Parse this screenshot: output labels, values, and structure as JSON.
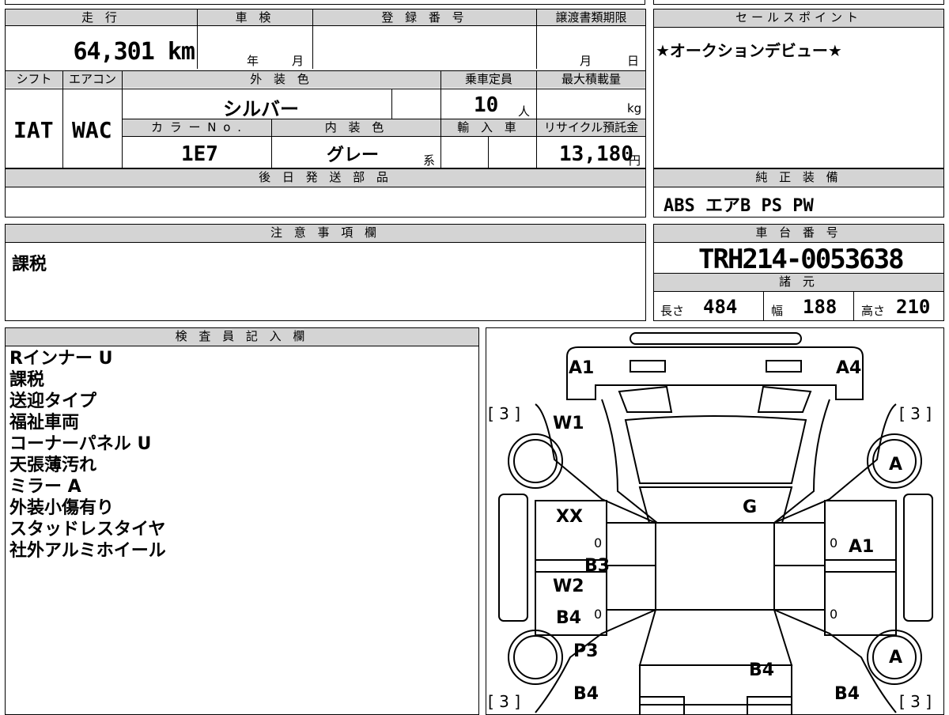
{
  "top": {
    "mileage_label": "走 行",
    "mileage_value": "64,301 km",
    "inspection_label": "車 検",
    "inspection_year": "年",
    "inspection_month": "月",
    "registration_label": "登 録 番 号",
    "transfer_label": "譲渡書類期限",
    "transfer_month": "月",
    "transfer_day": "日"
  },
  "row2": {
    "shift_label": "シフト",
    "aircon_label": "エアコン",
    "exterior_color_label": "外 装 色",
    "capacity_label": "乗車定員",
    "max_load_label": "最大積載量",
    "shift_value": "IAT",
    "aircon_value": "WAC",
    "exterior_color_value": "シルバー",
    "capacity_value": "10",
    "capacity_unit": "人",
    "load_unit": "kg",
    "color_no_label": "カ ラ ー N o .",
    "interior_color_label": "内 装 色",
    "import_label": "輸 入 車",
    "recycle_label": "リサイクル預託金",
    "color_no_value": "1E7",
    "interior_color_value": "グレー",
    "interior_suffix": "系",
    "recycle_value": "13,180",
    "recycle_unit": "円"
  },
  "later_parts": {
    "label": "後 日 発 送 部 品",
    "value": ""
  },
  "sales_point": {
    "label": "セールスポイント",
    "value": "★オークションデビュー★"
  },
  "equipment": {
    "label": "純 正 装 備",
    "value": "ABS エアB PS PW"
  },
  "caution": {
    "label": "注 意 事 項 欄",
    "value": "課税"
  },
  "chassis": {
    "label": "車 台 番 号",
    "value": "TRH214-0053638"
  },
  "specs": {
    "label": "諸 元",
    "length_label": "長さ",
    "length_value": "484",
    "width_label": "幅",
    "width_value": "188",
    "height_label": "高さ",
    "height_value": "210"
  },
  "inspector": {
    "label": "検 査 員 記 入 欄",
    "lines": [
      "Rインナー U",
      "課税",
      "送迎タイプ",
      "福祉車両",
      "コーナーパネル U",
      "天張薄汚れ",
      "ミラー A",
      "外装小傷有り",
      "スタッドレスタイヤ",
      "社外アルミホイール"
    ]
  },
  "diagram": {
    "marks": [
      "A1",
      "A4",
      "W1",
      "A",
      "XX",
      "G",
      "A1",
      "B3",
      "W2",
      "B4",
      "P3",
      "A",
      "B4",
      "B4",
      "B4"
    ],
    "tire_grades": [
      "[ 3 ]",
      "[ 3 ]",
      "[ 3 ]",
      "[ 3 ]"
    ],
    "zeros": [
      "0",
      "0",
      "0",
      "0"
    ]
  }
}
